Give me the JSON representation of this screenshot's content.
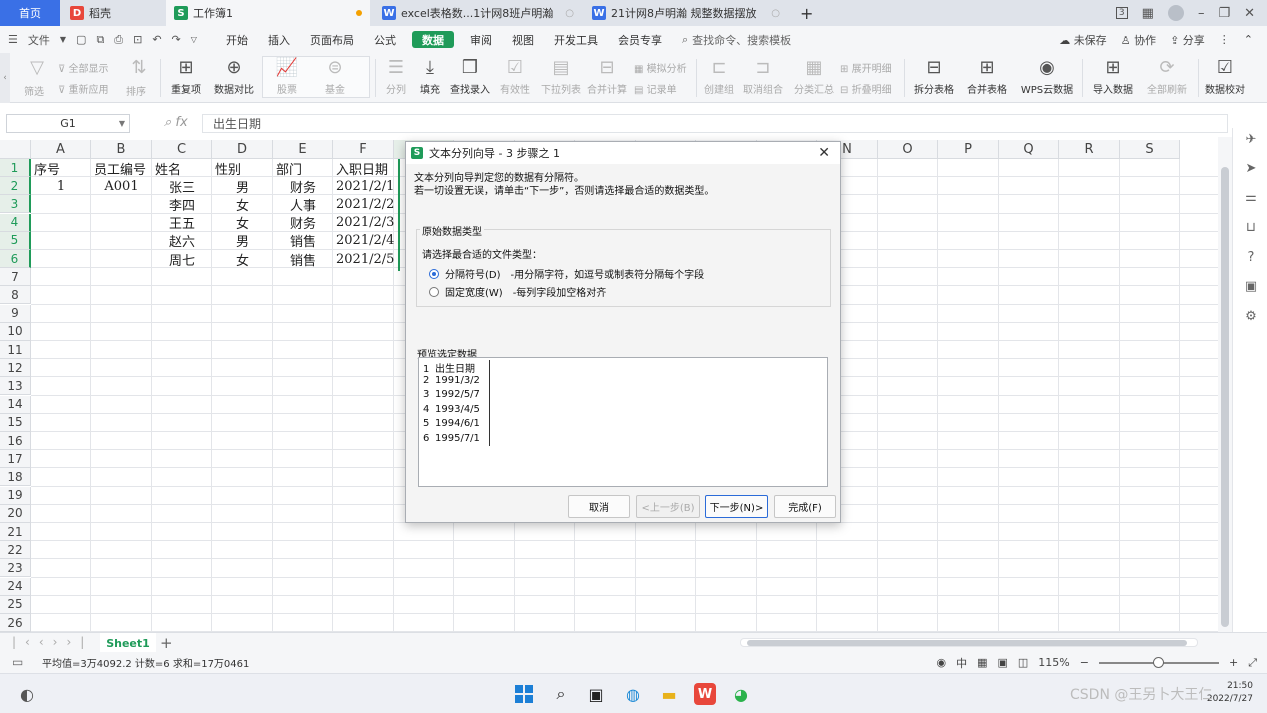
{
  "tabs": {
    "home": "首页",
    "items": [
      {
        "label": "稻壳",
        "icon": "docer-icon"
      },
      {
        "label": "工作簿1",
        "icon": "sheet-icon"
      },
      {
        "label": "excel表格数...1计网8班卢明瀚",
        "icon": "word-icon"
      },
      {
        "label": "21计网8卢明瀚 规整数据摆放",
        "icon": "word-icon"
      }
    ],
    "add": "+",
    "badge": "3"
  },
  "menu": {
    "file": "文件",
    "items": [
      "开始",
      "插入",
      "页面布局",
      "公式",
      "数据",
      "审阅",
      "视图",
      "开发工具",
      "会员专享"
    ],
    "active_index": 4,
    "search": "查找命令、搜索模板",
    "unsaved": "未保存",
    "collab": "协作",
    "share": "分享"
  },
  "ribbon": {
    "filter": "筛选",
    "show_all": "全部显示",
    "reapply": "重新应用",
    "sort": "排序",
    "duplicate": "重复项",
    "compare": "数据对比",
    "stock": "股票",
    "fund": "基金",
    "split_col": "分列",
    "fill": "填充",
    "find_entry": "查找录入",
    "validity": "有效性",
    "dropdown": "下拉列表",
    "merge_calc": "合并计算",
    "simulate": "模拟分析",
    "record": "记录单",
    "create_group": "创建组",
    "ungroup": "取消组合",
    "subtotal": "分类汇总",
    "expand": "展开明细",
    "collapse": "折叠明细",
    "split_table": "拆分表格",
    "merge_table": "合并表格",
    "wps_cloud": "WPS云数据",
    "import": "导入数据",
    "refresh_all": "全部刷新",
    "verify": "数据校对"
  },
  "formula": {
    "cell_ref": "G1",
    "fx": "fx",
    "content": "出生日期"
  },
  "grid": {
    "columns": [
      "A",
      "B",
      "C",
      "D",
      "E",
      "F",
      "G",
      "H",
      "I",
      "J",
      "K",
      "L",
      "M",
      "N",
      "O",
      "P",
      "Q",
      "R",
      "S"
    ],
    "rows": [
      "1",
      "2",
      "3",
      "4",
      "5",
      "6",
      "7",
      "8",
      "9",
      "10",
      "11",
      "12",
      "13",
      "14",
      "15",
      "16",
      "17",
      "18",
      "19",
      "20",
      "21",
      "22",
      "23",
      "24",
      "25",
      "26"
    ],
    "header": [
      "序号",
      "员工编号",
      "姓名",
      "性别",
      "部门",
      "入职日期"
    ],
    "data": [
      [
        "1",
        "A001",
        "张三",
        "男",
        "财务",
        "2021/2/1"
      ],
      [
        "",
        "",
        "李四",
        "女",
        "人事",
        "2021/2/2"
      ],
      [
        "",
        "",
        "王五",
        "女",
        "财务",
        "2021/2/3"
      ],
      [
        "",
        "",
        "赵六",
        "男",
        "销售",
        "2021/2/4"
      ],
      [
        "",
        "",
        "周七",
        "女",
        "销售",
        "2021/2/5"
      ]
    ]
  },
  "sheet": {
    "name": "Sheet1",
    "add": "+"
  },
  "status": {
    "summary": "平均值=3万4092.2  计数=6  求和=17万0461",
    "zoom": "115%"
  },
  "taskbar": {
    "time": "21:50",
    "date": "2022/7/27"
  },
  "watermark": "CSDN @王另卜大王仁",
  "dialog": {
    "title": "文本分列向导 - 3 步骤之 1",
    "desc_line1": "文本分列向导判定您的数据有分隔符。",
    "desc_line2": "若一切设置无误，请单击“下一步”，否则请选择最合适的数据类型。",
    "group_title": "原始数据类型",
    "prompt": "请选择最合适的文件类型：",
    "options": [
      {
        "label": "分隔符号(D)",
        "desc": "-用分隔字符，如逗号或制表符分隔每个字段",
        "selected": true
      },
      {
        "label": "固定宽度(W)",
        "desc": "-每列字段加空格对齐",
        "selected": false
      }
    ],
    "preview_title": "预览选定数据",
    "preview": [
      {
        "n": "1",
        "text": "出生日期"
      },
      {
        "n": "2",
        "text": "1991/3/2"
      },
      {
        "n": "3",
        "text": "1992/5/7"
      },
      {
        "n": "4",
        "text": "1993/4/5"
      },
      {
        "n": "5",
        "text": "1994/6/1"
      },
      {
        "n": "6",
        "text": "1995/7/1"
      }
    ],
    "buttons": {
      "cancel": "取消",
      "back": "<上一步(B)",
      "next": "下一步(N)>",
      "finish": "完成(F)"
    }
  }
}
